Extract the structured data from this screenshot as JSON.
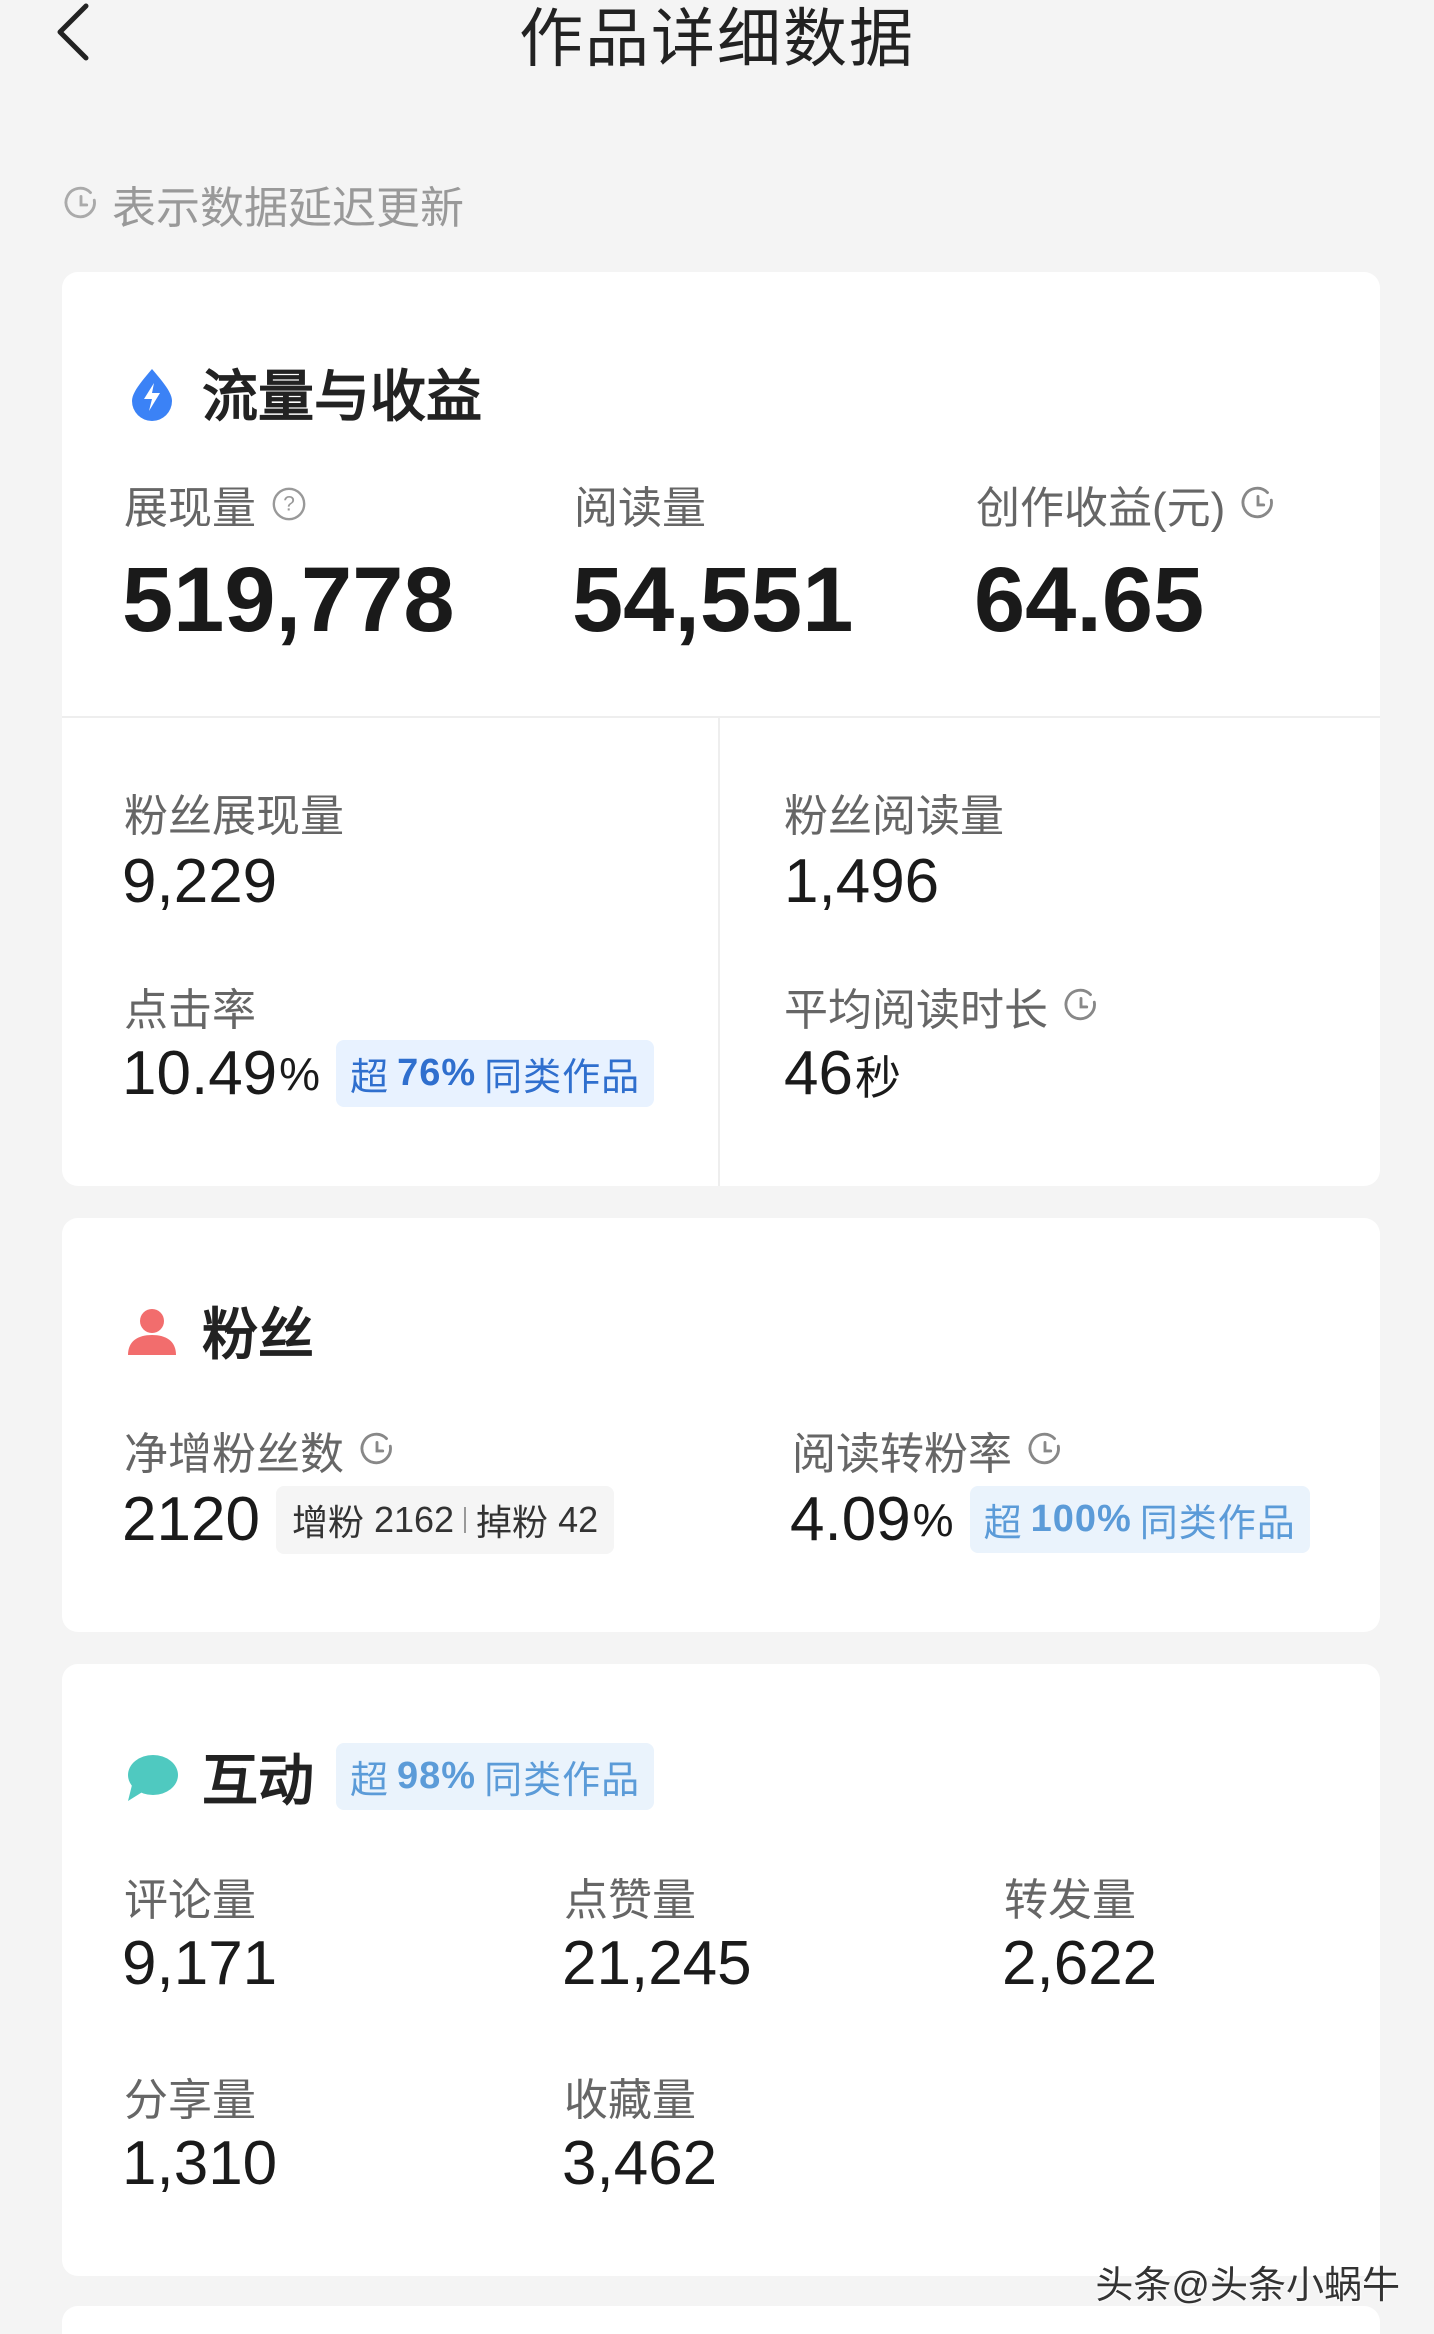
{
  "header": {
    "title": "作品详细数据"
  },
  "delay_note": "表示数据延迟更新",
  "traffic": {
    "title": "流量与收益",
    "impressions": {
      "label": "展现量",
      "value": "519,778"
    },
    "reads": {
      "label": "阅读量",
      "value": "54,551"
    },
    "earnings": {
      "label": "创作收益(元)",
      "value": "64.65"
    },
    "fan_impressions": {
      "label": "粉丝展现量",
      "value": "9,229"
    },
    "fan_reads": {
      "label": "粉丝阅读量",
      "value": "1,496"
    },
    "ctr": {
      "label": "点击率",
      "value": "10.49",
      "unit": "%",
      "badge_prefix": "超",
      "badge_pct": "76%",
      "badge_suffix": "同类作品"
    },
    "avg_time": {
      "label": "平均阅读时长",
      "value": "46",
      "unit": "秒"
    }
  },
  "fans": {
    "title": "粉丝",
    "net": {
      "label": "净增粉丝数",
      "value": "2120",
      "gain_label": "增粉",
      "gain": "2162",
      "loss_label": "掉粉",
      "loss": "42"
    },
    "conversion": {
      "label": "阅读转粉率",
      "value": "4.09",
      "unit": "%",
      "badge_prefix": "超",
      "badge_pct": "100%",
      "badge_suffix": "同类作品"
    }
  },
  "interaction": {
    "title": "互动",
    "badge_prefix": "超",
    "badge_pct": "98%",
    "badge_suffix": "同类作品",
    "comments": {
      "label": "评论量",
      "value": "9,171"
    },
    "likes": {
      "label": "点赞量",
      "value": "21,245"
    },
    "reposts": {
      "label": "转发量",
      "value": "2,622"
    },
    "shares": {
      "label": "分享量",
      "value": "1,310"
    },
    "favorites": {
      "label": "收藏量",
      "value": "3,462"
    }
  },
  "watermark": "头条@头条小蜗牛",
  "colors": {
    "accent_blue": "#3b82f6",
    "badge_text": "#2f6fce",
    "fans_icon": "#f26d6d",
    "chat_icon": "#4fc9c0"
  }
}
